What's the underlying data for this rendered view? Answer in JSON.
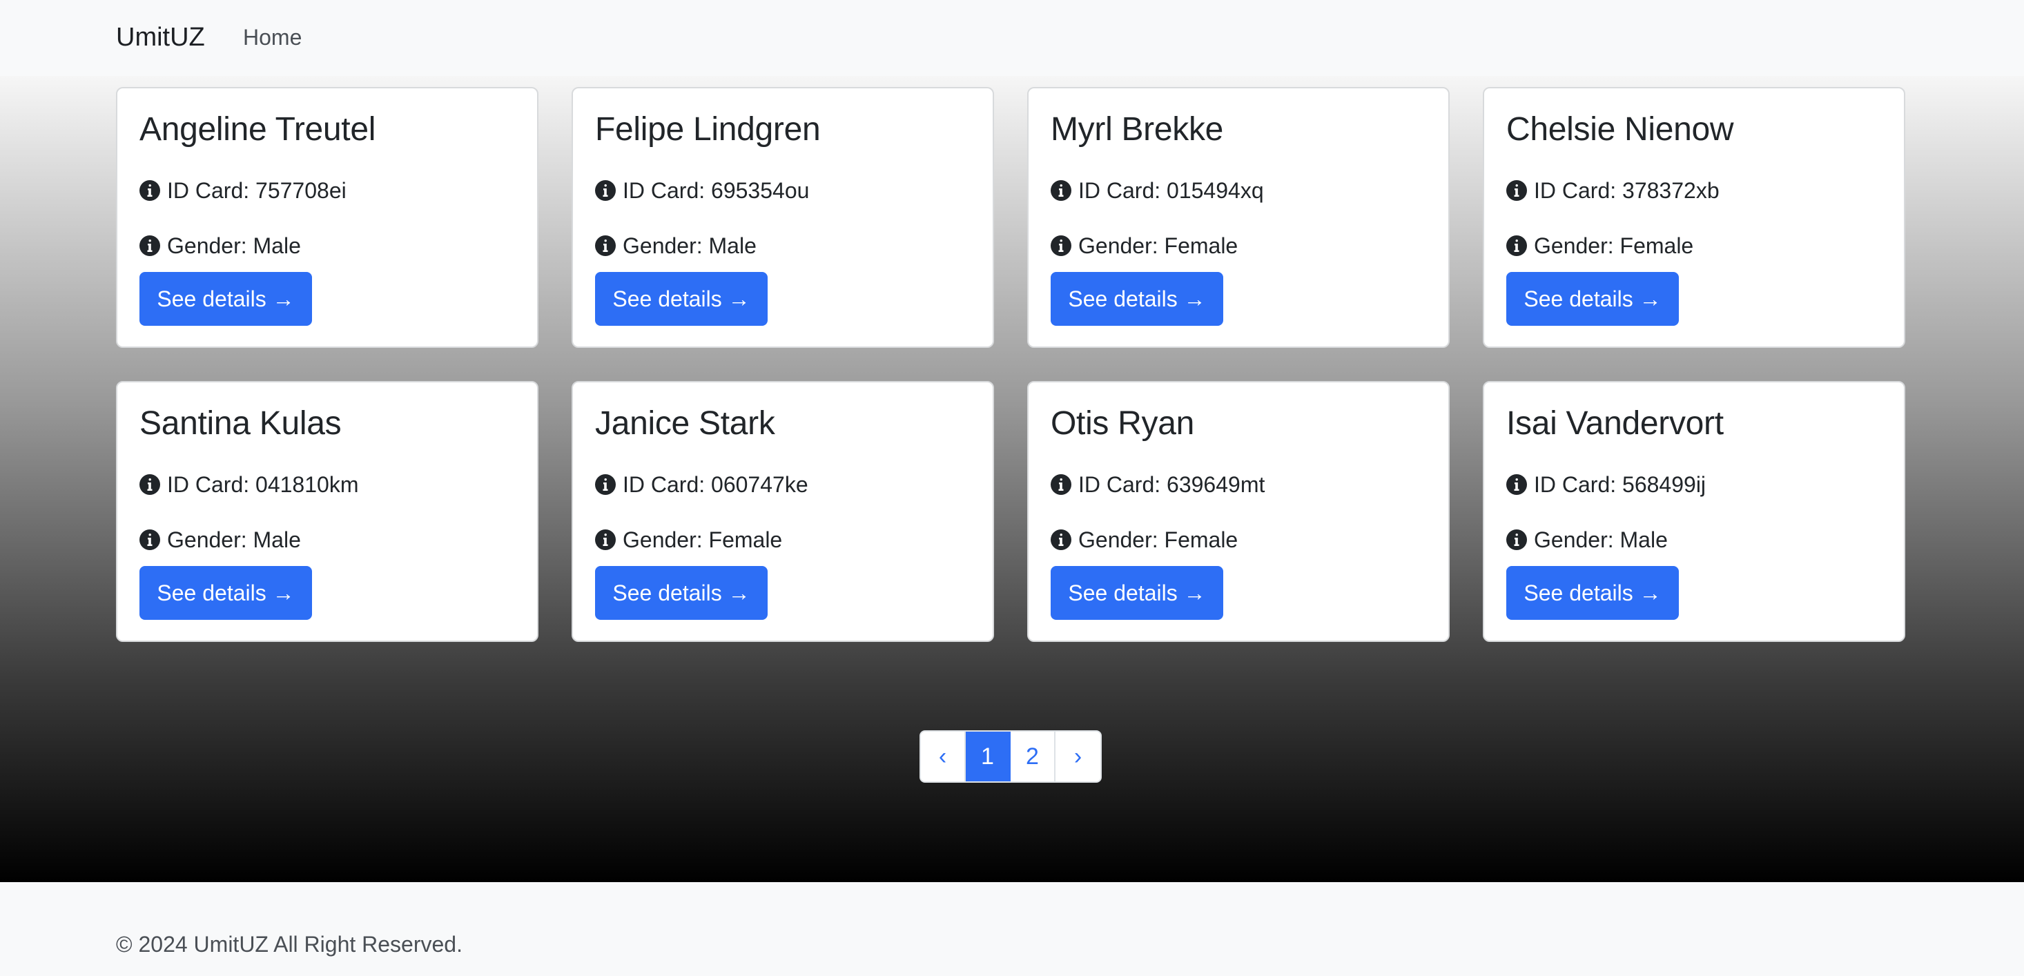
{
  "navbar": {
    "brand": "UmitUZ",
    "links": [
      "Home"
    ]
  },
  "cards": [
    {
      "name": "Angeline Treutel",
      "id_card": "ID Card: 757708ei",
      "gender": "Gender: Male",
      "button": "See details →"
    },
    {
      "name": "Felipe Lindgren",
      "id_card": "ID Card: 695354ou",
      "gender": "Gender: Male",
      "button": "See details →"
    },
    {
      "name": "Myrl Brekke",
      "id_card": "ID Card: 015494xq",
      "gender": "Gender: Female",
      "button": "See details →"
    },
    {
      "name": "Chelsie Nienow",
      "id_card": "ID Card: 378372xb",
      "gender": "Gender: Female",
      "button": "See details →"
    },
    {
      "name": "Santina Kulas",
      "id_card": "ID Card: 041810km",
      "gender": "Gender: Male",
      "button": "See details →"
    },
    {
      "name": "Janice Stark",
      "id_card": "ID Card: 060747ke",
      "gender": "Gender: Female",
      "button": "See details →"
    },
    {
      "name": "Otis Ryan",
      "id_card": "ID Card: 639649mt",
      "gender": "Gender: Female",
      "button": "See details →"
    },
    {
      "name": "Isai Vandervort",
      "id_card": "ID Card: 568499ij",
      "gender": "Gender: Male",
      "button": "See details →"
    }
  ],
  "pagination": {
    "prev": "‹",
    "pages": [
      "1",
      "2"
    ],
    "current": "1",
    "next": "›"
  },
  "footer": {
    "text": "© 2024 UmitUZ All Right Reserved."
  },
  "icons": {
    "info": "info-circle-icon"
  },
  "colors": {
    "primary": "#2d6ef5",
    "navbar_bg": "#f8f9fa",
    "text": "#212529"
  }
}
